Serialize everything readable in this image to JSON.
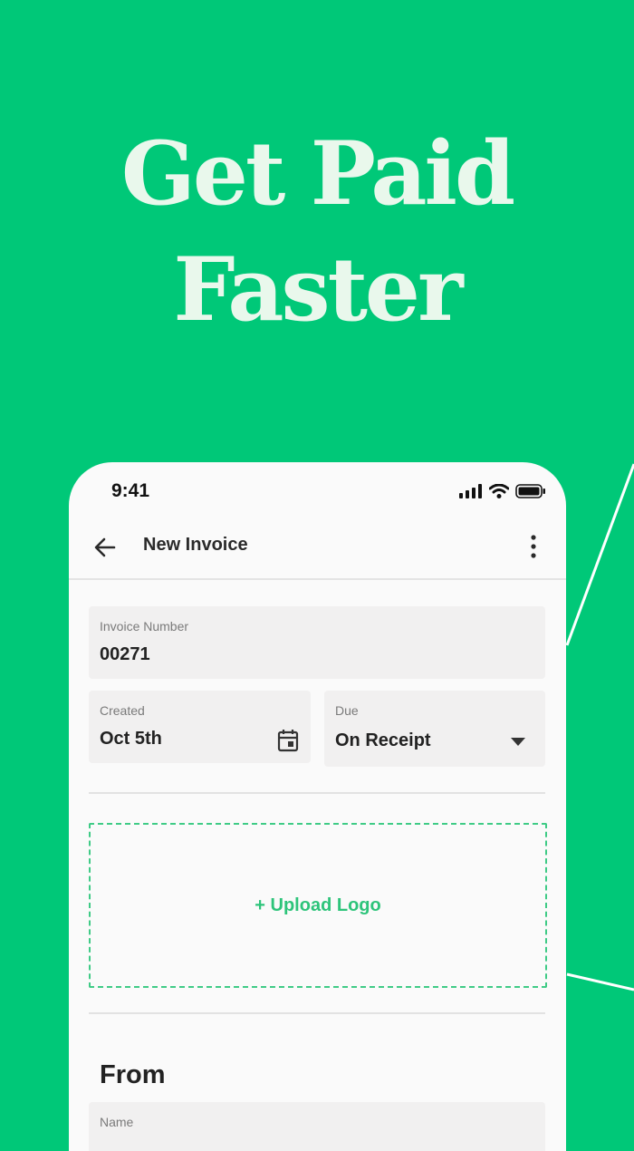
{
  "hero": {
    "line1": "Get Paid",
    "line2": "Faster"
  },
  "status_bar": {
    "time": "9:41",
    "icons": [
      "signal-icon",
      "wifi-icon",
      "battery-icon"
    ]
  },
  "app_bar": {
    "title": "New Invoice",
    "back_icon": "arrow-left-icon",
    "menu_icon": "more-vertical-icon"
  },
  "form": {
    "invoice_number": {
      "label": "Invoice Number",
      "value": "00271"
    },
    "created": {
      "label": "Created",
      "value": "Oct 5th",
      "icon": "calendar-icon"
    },
    "due": {
      "label": "Due",
      "value": "On Receipt",
      "icon": "dropdown-arrow-icon"
    },
    "upload_logo": "+ Upload Logo",
    "from_section": "From",
    "name_label": "Name"
  },
  "colors": {
    "brand_green": "#00C878",
    "headline": "#E9F8EC",
    "accent_green": "#2DC47A",
    "field_bg": "#F1F0F0"
  }
}
